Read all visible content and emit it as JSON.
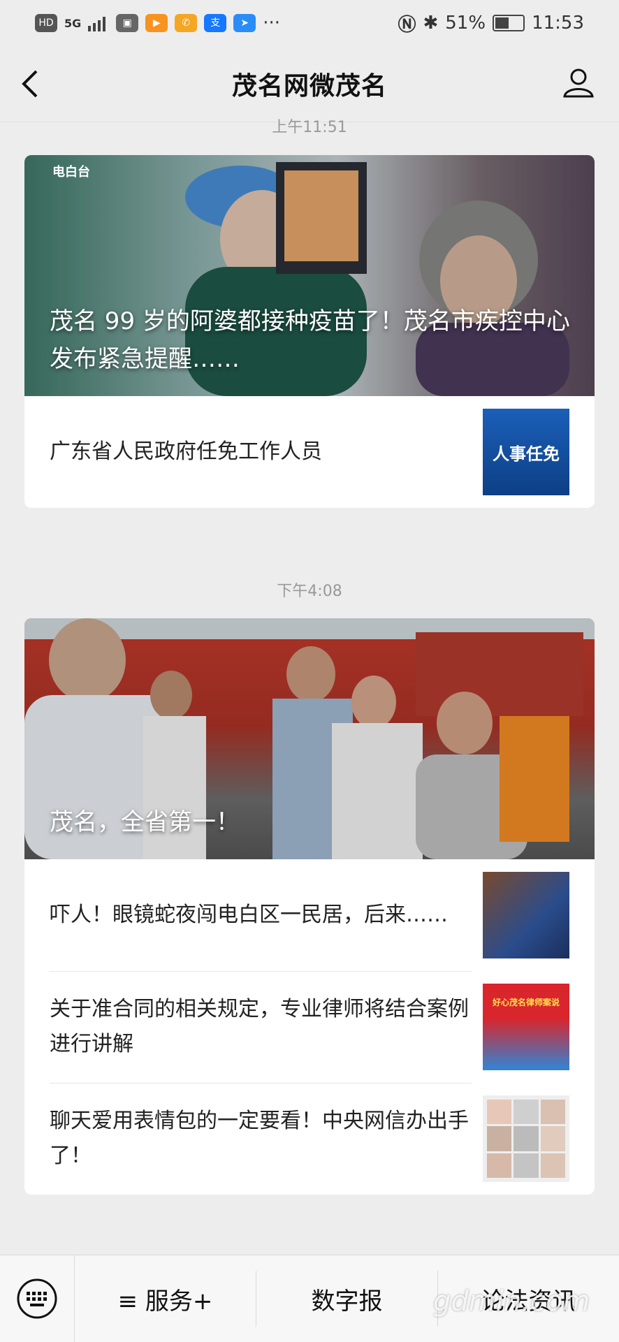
{
  "status_bar": {
    "network": "HD",
    "signal": "5G",
    "battery": "51%",
    "time": "11:53",
    "more": "···"
  },
  "nav": {
    "title": "茂名网微茂名",
    "back_icon": "chevron-left-icon",
    "profile_icon": "user-icon"
  },
  "groups": [
    {
      "timestamp": "上午11:51",
      "hero": {
        "title": "茂名 99 岁的阿婆都接种疫苗了！茂名市疾控中心发布紧急提醒……",
        "badge": "电白台"
      },
      "items": [
        {
          "title": "广东省人民政府任免工作人员",
          "thumb_text": "人事任免"
        }
      ]
    },
    {
      "timestamp": "下午4:08",
      "hero": {
        "title": "茂名，全省第一！"
      },
      "items": [
        {
          "title": "吓人！眼镜蛇夜闯电白区一民居，后来……"
        },
        {
          "title": "关于准合同的相关规定，专业律师将结合案例进行讲解",
          "thumb_text": "好心茂名律师案说"
        },
        {
          "title": "聊天爱用表情包的一定要看！中央网信办出手了！"
        }
      ]
    }
  ],
  "bottom_menu": {
    "keyboard_icon": "keyboard-icon",
    "items": [
      "≡ 服务+",
      "数字报",
      "论法资讯"
    ]
  },
  "watermark": "gdmin.com"
}
